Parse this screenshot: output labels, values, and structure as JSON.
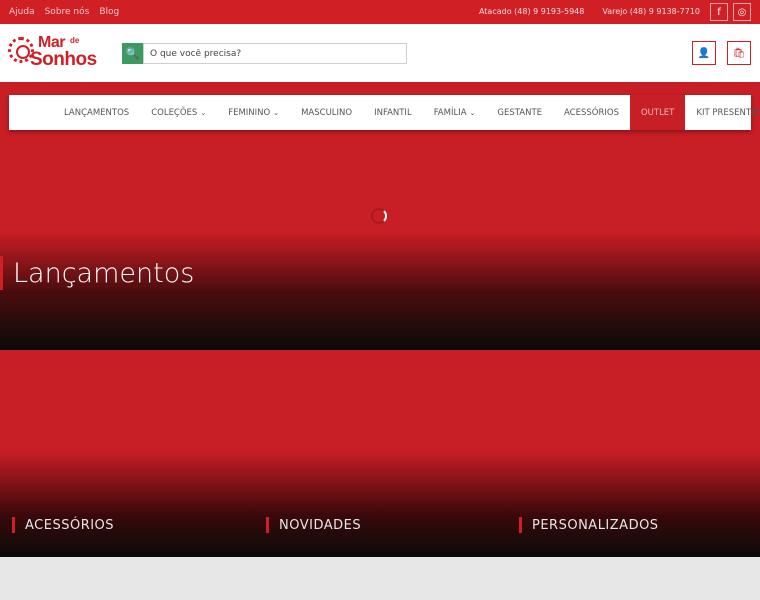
{
  "topbar": {
    "links": [
      "Ajuda",
      "Sobre nós",
      "Blog"
    ],
    "atacado": "Atacado (48) 9 9193-5948",
    "varejo": "Varejo (48) 9 9138-7710",
    "social": [
      {
        "name": "facebook-icon",
        "glyph": "f"
      },
      {
        "name": "instagram-icon",
        "glyph": "◎"
      }
    ]
  },
  "logo": {
    "word1": "Mar",
    "word2": "de",
    "word3": "Sonhos"
  },
  "search": {
    "placeholder": "O que você precisa?",
    "icon": "🔍"
  },
  "header_buttons": {
    "user_icon": "👤",
    "cart_icon": "🛍"
  },
  "nav": {
    "items": [
      {
        "label": "LANÇAMENTOS",
        "dropdown": false
      },
      {
        "label": "COLEÇÕES",
        "dropdown": true
      },
      {
        "label": "FEMININO",
        "dropdown": true
      },
      {
        "label": "MASCULINO",
        "dropdown": false
      },
      {
        "label": "INFANTIL",
        "dropdown": false
      },
      {
        "label": "FAMÍLIA",
        "dropdown": true
      },
      {
        "label": "GESTANTE",
        "dropdown": false
      },
      {
        "label": "ACESSÓRIOS",
        "dropdown": false
      },
      {
        "label": "OUTLET",
        "dropdown": false
      },
      {
        "label": "KIT PRESENTES",
        "dropdown": false
      }
    ],
    "chevron": "⌄"
  },
  "hero": {
    "title": "Lançamentos"
  },
  "categories": [
    "ACESSÓRIOS",
    "NOVIDADES",
    "PERSONALIZADOS"
  ],
  "colors": {
    "brand": "#d11f26",
    "search_button": "#3c9a61"
  }
}
